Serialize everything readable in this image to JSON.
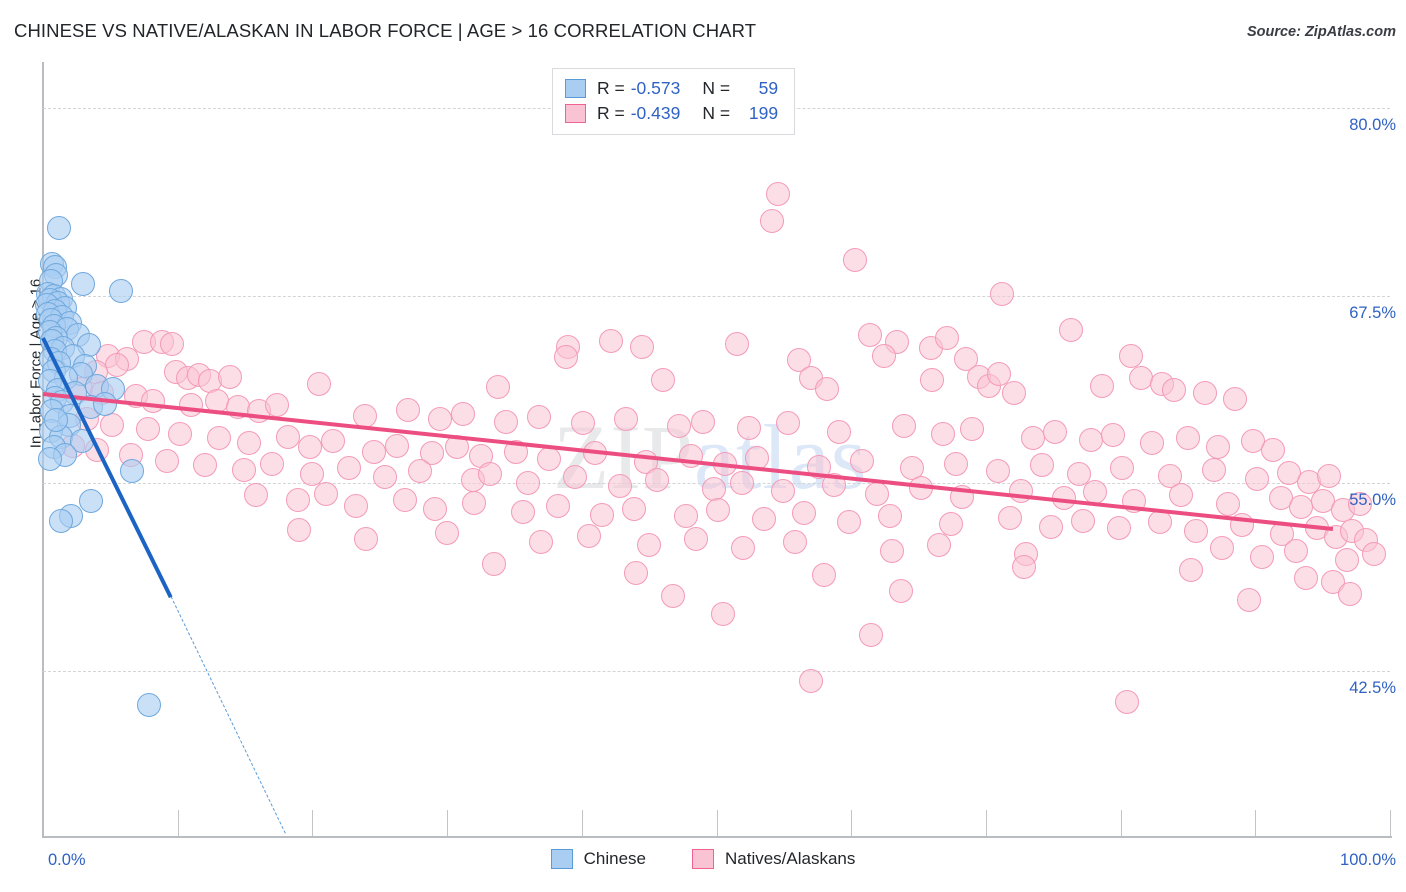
{
  "header": {
    "title": "CHINESE VS NATIVE/ALASKAN IN LABOR FORCE | AGE > 16 CORRELATION CHART",
    "source": "Source: ZipAtlas.com"
  },
  "watermark": {
    "part1": "ZIP",
    "part2": "atlas"
  },
  "stats_legend": {
    "rows": [
      {
        "swatch": "blue",
        "r_label": "R =",
        "r_value": "-0.573",
        "n_label": "N =",
        "n_value": "59"
      },
      {
        "swatch": "pink",
        "r_label": "R =",
        "r_value": "-0.439",
        "n_label": "N =",
        "n_value": "199"
      }
    ]
  },
  "series_legend": [
    {
      "name": "Chinese",
      "color": "#aacdf2",
      "border": "#5b9bd5"
    },
    {
      "name": "Natives/Alaskans",
      "color": "#fac3d3",
      "border": "#f06292"
    }
  ],
  "colors": {
    "blue_fill": "#aacdf2",
    "blue_stroke": "#6fa8dc",
    "blue_trend": "#1c64c4",
    "pink_fill": "#fac3d3",
    "pink_stroke": "#f49ab8",
    "pink_trend": "#ec4e82",
    "axis_label": "#2f62c4",
    "grid": "#d3d4d6"
  },
  "chart_data": {
    "type": "scatter",
    "title": "CHINESE VS NATIVE/ALASKAN IN LABOR FORCE | AGE > 16 CORRELATION CHART",
    "xlabel": "",
    "ylabel": "In Labor Force | Age > 16",
    "xlim": [
      0,
      100
    ],
    "ylim": [
      31.5,
      83.0
    ],
    "grid": true,
    "legend_position": "bottom-center",
    "x_ticks": [
      0,
      10,
      20,
      30,
      40,
      50,
      60,
      70,
      80,
      90,
      100
    ],
    "x_tick_labels": [
      "0.0%",
      "",
      "",
      "",
      "",
      "",
      "",
      "",
      "",
      "",
      "100.0%"
    ],
    "y_ticks": [
      42.5,
      55.0,
      67.5,
      80.0
    ],
    "y_tick_labels": [
      "42.5%",
      "55.0%",
      "67.5%",
      "80.0%"
    ],
    "series": [
      {
        "name": "Chinese",
        "color": "#aacdf2",
        "r": -0.573,
        "n": 59,
        "trendline": {
          "x0": 0.0,
          "y0": 64.8,
          "x1": 9.5,
          "y1": 47.5,
          "dashed_to": {
            "x": 18.0,
            "y": 31.7
          }
        },
        "points": [
          [
            1.2,
            72.0
          ],
          [
            0.7,
            69.6
          ],
          [
            0.9,
            69.4
          ],
          [
            1.0,
            68.9
          ],
          [
            0.6,
            68.5
          ],
          [
            3.0,
            68.3
          ],
          [
            5.8,
            67.8
          ],
          [
            0.4,
            67.6
          ],
          [
            0.8,
            67.5
          ],
          [
            1.3,
            67.3
          ],
          [
            0.5,
            67.2
          ],
          [
            1.1,
            67.0
          ],
          [
            0.3,
            66.9
          ],
          [
            1.6,
            66.7
          ],
          [
            0.9,
            66.5
          ],
          [
            0.4,
            66.3
          ],
          [
            1.4,
            66.1
          ],
          [
            0.6,
            65.9
          ],
          [
            2.0,
            65.7
          ],
          [
            0.8,
            65.5
          ],
          [
            1.8,
            65.3
          ],
          [
            0.5,
            65.1
          ],
          [
            2.6,
            64.9
          ],
          [
            1.0,
            64.7
          ],
          [
            0.7,
            64.5
          ],
          [
            3.4,
            64.2
          ],
          [
            1.5,
            64.0
          ],
          [
            0.9,
            63.8
          ],
          [
            2.2,
            63.5
          ],
          [
            0.6,
            63.3
          ],
          [
            1.2,
            63.0
          ],
          [
            3.1,
            62.8
          ],
          [
            0.8,
            62.5
          ],
          [
            2.8,
            62.3
          ],
          [
            1.7,
            62.0
          ],
          [
            0.5,
            61.8
          ],
          [
            4.0,
            61.5
          ],
          [
            1.1,
            61.2
          ],
          [
            2.4,
            61.0
          ],
          [
            0.9,
            60.7
          ],
          [
            1.4,
            60.4
          ],
          [
            3.6,
            60.1
          ],
          [
            0.7,
            59.8
          ],
          [
            2.0,
            59.5
          ],
          [
            5.2,
            61.3
          ],
          [
            1.9,
            58.9
          ],
          [
            0.6,
            58.5
          ],
          [
            4.6,
            60.3
          ],
          [
            1.3,
            58.1
          ],
          [
            2.9,
            57.8
          ],
          [
            0.8,
            57.4
          ],
          [
            1.0,
            59.2
          ],
          [
            1.6,
            56.9
          ],
          [
            0.5,
            56.6
          ],
          [
            6.6,
            55.8
          ],
          [
            2.1,
            52.8
          ],
          [
            3.6,
            53.8
          ],
          [
            1.3,
            52.5
          ],
          [
            7.9,
            40.2
          ]
        ]
      },
      {
        "name": "Natives/Alaskans",
        "color": "#fac3d3",
        "r": -0.439,
        "n": 199,
        "trendline": {
          "x0": 0.0,
          "y0": 61.1,
          "x1": 95.8,
          "y1": 52.1
        },
        "points": [
          [
            54.6,
            74.3
          ],
          [
            54.1,
            72.5
          ],
          [
            60.3,
            69.9
          ],
          [
            71.2,
            67.6
          ],
          [
            76.3,
            65.2
          ],
          [
            7.5,
            64.4
          ],
          [
            8.8,
            64.4
          ],
          [
            9.6,
            64.3
          ],
          [
            39.0,
            64.1
          ],
          [
            42.2,
            64.5
          ],
          [
            44.5,
            64.1
          ],
          [
            51.5,
            64.3
          ],
          [
            61.4,
            64.9
          ],
          [
            63.4,
            64.4
          ],
          [
            65.9,
            64.0
          ],
          [
            67.1,
            64.7
          ],
          [
            4.8,
            63.5
          ],
          [
            6.2,
            63.3
          ],
          [
            5.5,
            62.9
          ],
          [
            38.8,
            63.4
          ],
          [
            56.1,
            63.2
          ],
          [
            62.4,
            63.5
          ],
          [
            68.5,
            63.3
          ],
          [
            3.9,
            62.4
          ],
          [
            9.9,
            62.4
          ],
          [
            10.8,
            62.0
          ],
          [
            11.6,
            62.2
          ],
          [
            12.4,
            61.8
          ],
          [
            13.9,
            62.1
          ],
          [
            20.5,
            61.6
          ],
          [
            33.8,
            61.4
          ],
          [
            46.0,
            61.9
          ],
          [
            57.0,
            62.0
          ],
          [
            58.2,
            61.3
          ],
          [
            66.0,
            61.9
          ],
          [
            69.5,
            62.1
          ],
          [
            70.2,
            61.5
          ],
          [
            71.0,
            62.3
          ],
          [
            72.1,
            61.0
          ],
          [
            78.6,
            61.5
          ],
          [
            80.8,
            63.5
          ],
          [
            81.5,
            62.0
          ],
          [
            83.1,
            61.6
          ],
          [
            84.0,
            61.2
          ],
          [
            86.3,
            61.0
          ],
          [
            88.5,
            60.6
          ],
          [
            2.8,
            61.3
          ],
          [
            4.4,
            61.0
          ],
          [
            6.9,
            60.8
          ],
          [
            8.2,
            60.5
          ],
          [
            11.0,
            60.2
          ],
          [
            12.9,
            60.5
          ],
          [
            14.5,
            60.1
          ],
          [
            16.0,
            59.8
          ],
          [
            17.4,
            60.2
          ],
          [
            23.9,
            59.5
          ],
          [
            27.1,
            59.9
          ],
          [
            29.5,
            59.3
          ],
          [
            31.2,
            59.6
          ],
          [
            34.4,
            59.1
          ],
          [
            36.8,
            59.4
          ],
          [
            40.1,
            59.0
          ],
          [
            43.3,
            59.3
          ],
          [
            47.2,
            58.8
          ],
          [
            49.0,
            59.1
          ],
          [
            52.4,
            58.7
          ],
          [
            55.3,
            59.0
          ],
          [
            59.1,
            58.4
          ],
          [
            63.9,
            58.8
          ],
          [
            66.8,
            58.3
          ],
          [
            69.0,
            58.6
          ],
          [
            73.5,
            58.0
          ],
          [
            75.1,
            58.4
          ],
          [
            77.8,
            57.9
          ],
          [
            79.4,
            58.2
          ],
          [
            82.3,
            57.7
          ],
          [
            85.0,
            58.0
          ],
          [
            87.2,
            57.4
          ],
          [
            89.8,
            57.8
          ],
          [
            91.3,
            57.2
          ],
          [
            3.3,
            59.3
          ],
          [
            5.1,
            58.9
          ],
          [
            7.8,
            58.6
          ],
          [
            10.2,
            58.3
          ],
          [
            13.1,
            58.0
          ],
          [
            15.3,
            57.7
          ],
          [
            18.2,
            58.1
          ],
          [
            19.8,
            57.4
          ],
          [
            21.5,
            57.8
          ],
          [
            24.6,
            57.1
          ],
          [
            26.3,
            57.5
          ],
          [
            28.9,
            57.0
          ],
          [
            30.7,
            57.4
          ],
          [
            32.5,
            56.8
          ],
          [
            35.1,
            57.1
          ],
          [
            37.6,
            56.6
          ],
          [
            41.0,
            57.0
          ],
          [
            44.8,
            56.4
          ],
          [
            48.1,
            56.8
          ],
          [
            50.6,
            56.3
          ],
          [
            53.0,
            56.7
          ],
          [
            57.6,
            56.1
          ],
          [
            60.8,
            56.5
          ],
          [
            64.5,
            56.0
          ],
          [
            67.8,
            56.3
          ],
          [
            70.9,
            55.8
          ],
          [
            74.2,
            56.2
          ],
          [
            76.9,
            55.6
          ],
          [
            80.1,
            56.0
          ],
          [
            83.7,
            55.5
          ],
          [
            86.9,
            55.9
          ],
          [
            90.1,
            55.3
          ],
          [
            92.5,
            55.7
          ],
          [
            94.0,
            55.1
          ],
          [
            95.5,
            55.5
          ],
          [
            2.2,
            57.5
          ],
          [
            4.0,
            57.2
          ],
          [
            6.5,
            56.9
          ],
          [
            9.2,
            56.5
          ],
          [
            12.0,
            56.2
          ],
          [
            14.9,
            55.9
          ],
          [
            17.0,
            56.3
          ],
          [
            20.0,
            55.6
          ],
          [
            22.7,
            56.0
          ],
          [
            25.4,
            55.4
          ],
          [
            28.0,
            55.8
          ],
          [
            31.9,
            55.2
          ],
          [
            33.2,
            55.6
          ],
          [
            36.0,
            55.0
          ],
          [
            39.5,
            55.4
          ],
          [
            42.8,
            54.8
          ],
          [
            45.6,
            55.2
          ],
          [
            49.8,
            54.6
          ],
          [
            51.9,
            55.0
          ],
          [
            54.9,
            54.5
          ],
          [
            58.7,
            54.9
          ],
          [
            61.9,
            54.3
          ],
          [
            65.2,
            54.7
          ],
          [
            68.2,
            54.1
          ],
          [
            72.6,
            54.5
          ],
          [
            75.8,
            54.0
          ],
          [
            78.1,
            54.4
          ],
          [
            81.0,
            53.8
          ],
          [
            84.5,
            54.2
          ],
          [
            88.0,
            53.6
          ],
          [
            91.9,
            54.0
          ],
          [
            93.4,
            53.4
          ],
          [
            95.0,
            53.8
          ],
          [
            96.5,
            53.2
          ],
          [
            97.8,
            53.6
          ],
          [
            15.8,
            54.2
          ],
          [
            18.9,
            53.9
          ],
          [
            21.0,
            54.3
          ],
          [
            23.2,
            53.5
          ],
          [
            26.9,
            53.9
          ],
          [
            29.1,
            53.3
          ],
          [
            32.0,
            53.7
          ],
          [
            35.6,
            53.1
          ],
          [
            38.2,
            53.5
          ],
          [
            41.5,
            52.9
          ],
          [
            43.9,
            53.3
          ],
          [
            47.7,
            52.8
          ],
          [
            50.1,
            53.2
          ],
          [
            53.5,
            52.6
          ],
          [
            56.5,
            53.0
          ],
          [
            59.8,
            52.4
          ],
          [
            62.9,
            52.8
          ],
          [
            67.4,
            52.3
          ],
          [
            71.8,
            52.7
          ],
          [
            74.8,
            52.1
          ],
          [
            77.2,
            52.5
          ],
          [
            79.9,
            52.0
          ],
          [
            82.9,
            52.4
          ],
          [
            85.6,
            51.8
          ],
          [
            89.0,
            52.2
          ],
          [
            92.0,
            51.6
          ],
          [
            94.6,
            52.0
          ],
          [
            96.0,
            51.4
          ],
          [
            97.2,
            51.8
          ],
          [
            98.2,
            51.2
          ],
          [
            19.0,
            51.9
          ],
          [
            24.0,
            51.3
          ],
          [
            30.0,
            51.7
          ],
          [
            37.0,
            51.1
          ],
          [
            40.5,
            51.5
          ],
          [
            45.0,
            50.9
          ],
          [
            48.5,
            51.3
          ],
          [
            52.0,
            50.7
          ],
          [
            55.8,
            51.1
          ],
          [
            63.0,
            50.5
          ],
          [
            66.5,
            50.9
          ],
          [
            73.0,
            50.3
          ],
          [
            87.5,
            50.7
          ],
          [
            90.5,
            50.1
          ],
          [
            93.0,
            50.5
          ],
          [
            96.8,
            49.9
          ],
          [
            98.8,
            50.3
          ],
          [
            33.5,
            49.6
          ],
          [
            44.0,
            49.0
          ],
          [
            58.0,
            48.9
          ],
          [
            72.8,
            49.4
          ],
          [
            85.2,
            49.2
          ],
          [
            93.8,
            48.7
          ],
          [
            95.8,
            48.4
          ],
          [
            46.8,
            47.5
          ],
          [
            63.7,
            47.8
          ],
          [
            89.5,
            47.2
          ],
          [
            97.0,
            47.6
          ],
          [
            50.5,
            46.3
          ],
          [
            61.5,
            44.9
          ],
          [
            57.0,
            41.8
          ],
          [
            80.5,
            40.4
          ]
        ]
      }
    ]
  }
}
